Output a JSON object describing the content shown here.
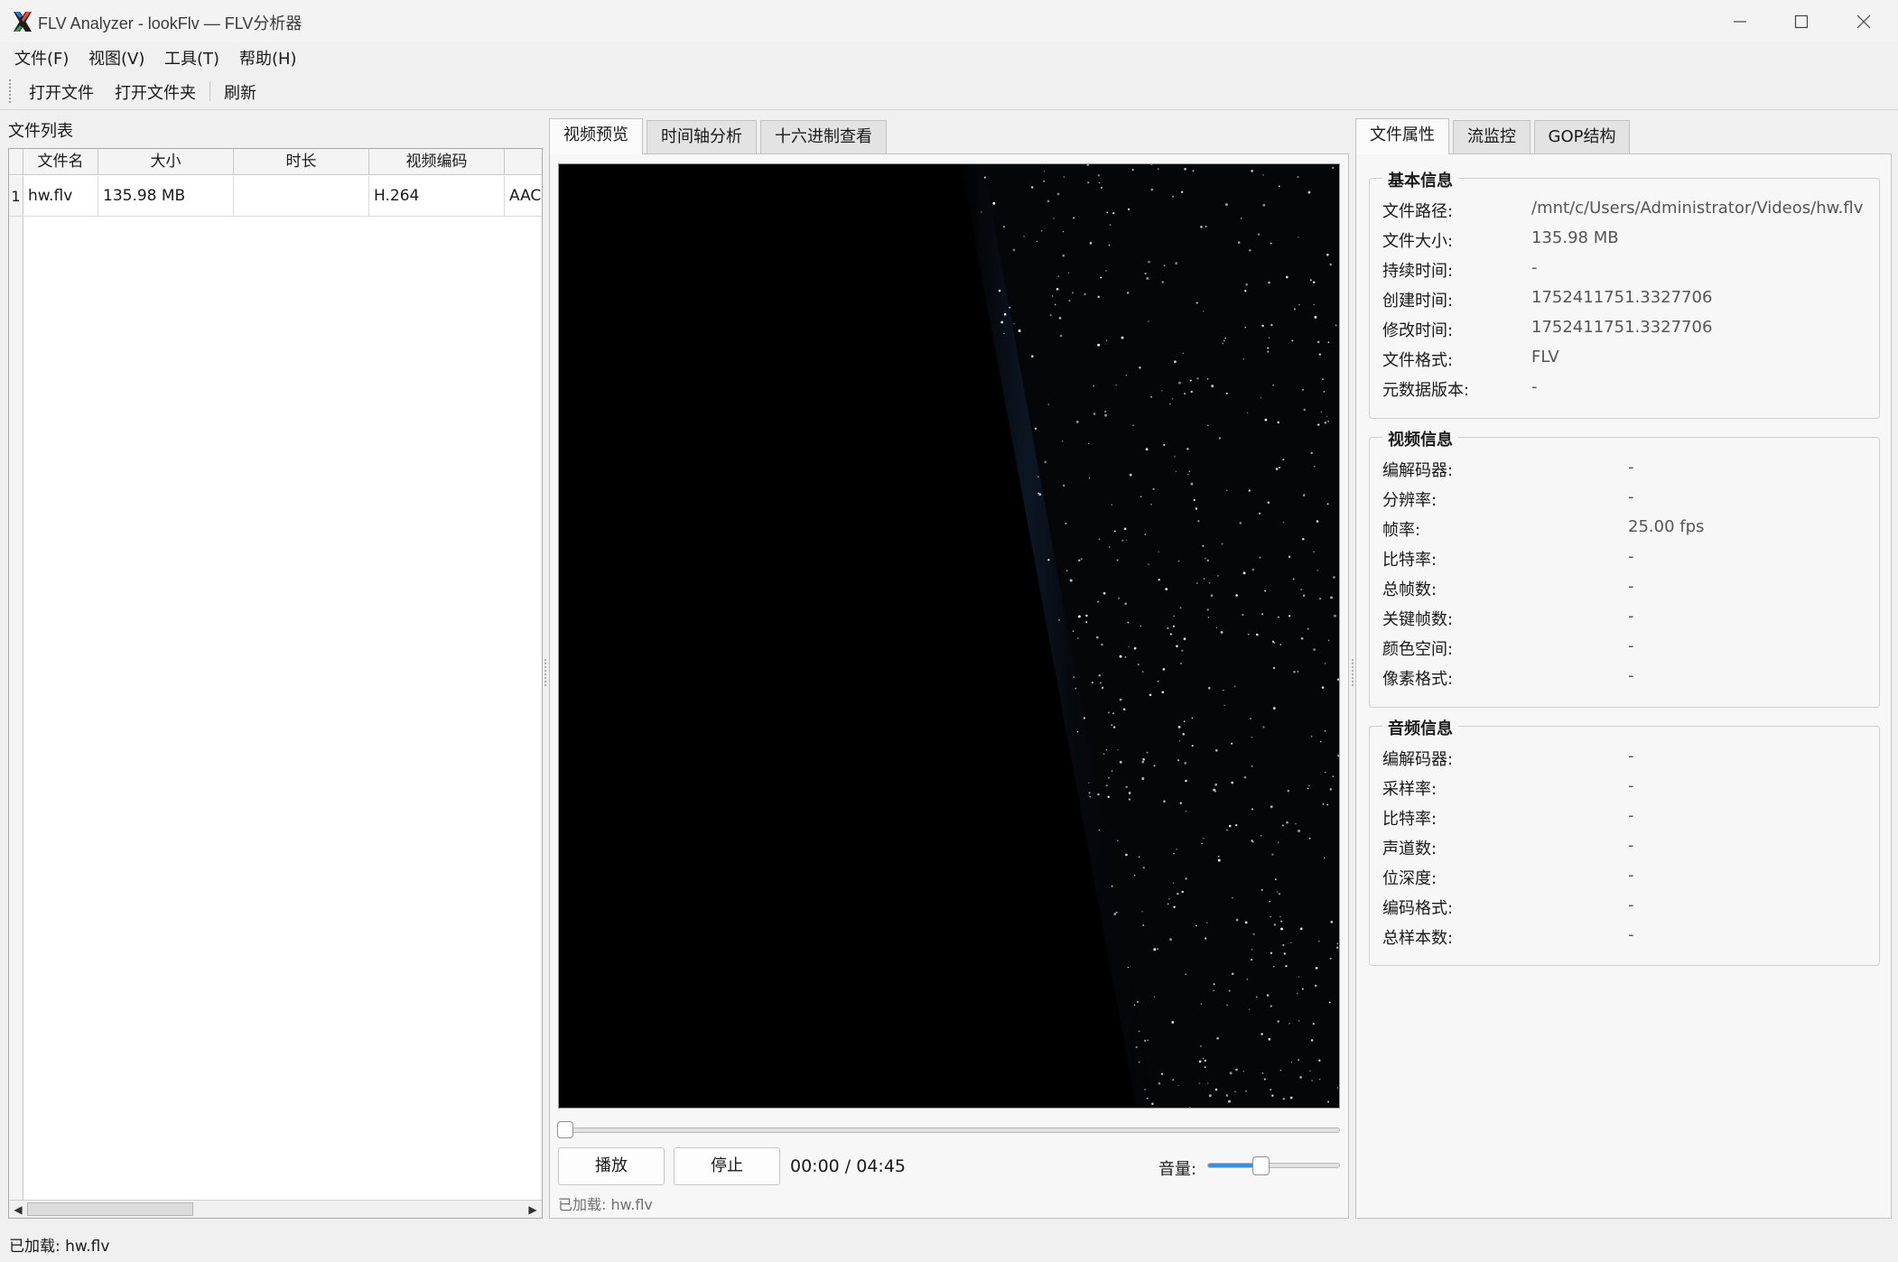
{
  "window": {
    "title": "FLV Analyzer - lookFlv — FLV分析器"
  },
  "menu": [
    "文件(F)",
    "视图(V)",
    "工具(T)",
    "帮助(H)"
  ],
  "toolbar": {
    "open_file": "打开文件",
    "open_folder": "打开文件夹",
    "refresh": "刷新"
  },
  "file_list": {
    "label": "文件列表",
    "headers": [
      "文件名",
      "大小",
      "时长",
      "视频编码",
      "音"
    ],
    "rows": [
      {
        "num": "1",
        "name": "hw.flv",
        "size": "135.98 MB",
        "duration": "",
        "video_codec": "H.264",
        "audio": "AAC"
      }
    ]
  },
  "center_tabs": [
    "视频预览",
    "时间轴分析",
    "十六进制查看"
  ],
  "player": {
    "play": "播放",
    "stop": "停止",
    "time": "00:00 / 04:45",
    "volume_label": "音量:",
    "volume_level": 0.4,
    "seek_position": 0.0,
    "loaded": "已加载: hw.flv"
  },
  "right_tabs": [
    "文件属性",
    "流监控",
    "GOP结构"
  ],
  "basic_info": {
    "title": "基本信息",
    "rows": [
      {
        "key": "文件路径:",
        "value": "/mnt/c/Users/Administrator/Videos/hw.flv"
      },
      {
        "key": "文件大小:",
        "value": "135.98 MB"
      },
      {
        "key": "持续时间:",
        "value": "-"
      },
      {
        "key": "创建时间:",
        "value": "1752411751.3327706"
      },
      {
        "key": "修改时间:",
        "value": "1752411751.3327706"
      },
      {
        "key": "文件格式:",
        "value": "FLV"
      },
      {
        "key": "元数据版本:",
        "value": "-"
      }
    ]
  },
  "video_info": {
    "title": "视频信息",
    "rows": [
      {
        "key": "编解码器:",
        "value": "-"
      },
      {
        "key": "分辨率:",
        "value": "-"
      },
      {
        "key": "帧率:",
        "value": "25.00 fps"
      },
      {
        "key": "比特率:",
        "value": "-"
      },
      {
        "key": "总帧数:",
        "value": "-"
      },
      {
        "key": "关键帧数:",
        "value": "-"
      },
      {
        "key": "颜色空间:",
        "value": "-"
      },
      {
        "key": "像素格式:",
        "value": "-"
      }
    ]
  },
  "audio_info": {
    "title": "音频信息",
    "rows": [
      {
        "key": "编解码器:",
        "value": "-"
      },
      {
        "key": "采样率:",
        "value": "-"
      },
      {
        "key": "比特率:",
        "value": "-"
      },
      {
        "key": "声道数:",
        "value": "-"
      },
      {
        "key": "位深度:",
        "value": "-"
      },
      {
        "key": "编码格式:",
        "value": "-"
      },
      {
        "key": "总样本数:",
        "value": "-"
      }
    ]
  },
  "status_bar": {
    "text": "已加载: hw.flv"
  }
}
